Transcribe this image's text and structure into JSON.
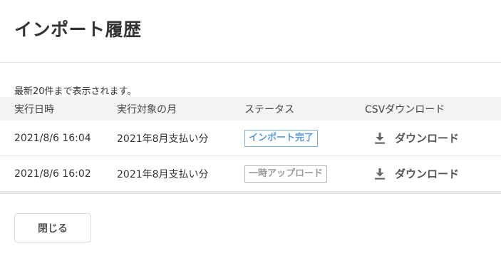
{
  "dialog": {
    "title": "インポート履歴",
    "note": "最新20件まで表示されます。",
    "close_label": "閉じる"
  },
  "table": {
    "headers": [
      "実行日時",
      "実行対象の月",
      "ステータス",
      "CSVダウンロード"
    ],
    "rows": [
      {
        "datetime": "2021/8/6 16:04",
        "target_month": "2021年8月支払い分",
        "status": "インポート完了",
        "download_label": "ダウンロード"
      },
      {
        "datetime": "2021/8/6 16:02",
        "target_month": "2021年8月支払い分",
        "status": "一時アップロード",
        "download_label": "ダウンロード"
      }
    ]
  },
  "colors": {
    "status_done": "#5b9bd9",
    "status_temp": "#9a9a9a",
    "header_bg": "#f4f2f2"
  },
  "icons": {
    "download": "download-icon"
  }
}
